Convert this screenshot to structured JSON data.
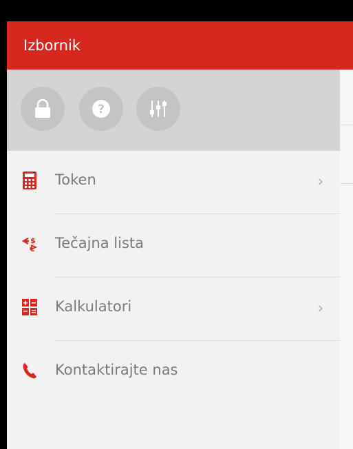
{
  "colors": {
    "accent": "#d6281f",
    "quick_row_bg": "#d4d4d4",
    "icon_circle": "#c4c4c4",
    "menu_text": "#7a7a7a"
  },
  "drawer": {
    "title": "Izbornik",
    "quick_actions": [
      {
        "icon": "lock-icon"
      },
      {
        "icon": "help-icon"
      },
      {
        "icon": "settings-sliders-icon"
      }
    ],
    "items": [
      {
        "label": "Token",
        "icon": "calculator-icon",
        "chevron": "›"
      },
      {
        "label": "Tečajna lista",
        "icon": "currency-exchange-icon"
      },
      {
        "label": "Kalkulatori",
        "icon": "calculators-icon",
        "chevron": "›"
      },
      {
        "label": "Kontaktirajte nas",
        "icon": "phone-icon"
      }
    ]
  }
}
